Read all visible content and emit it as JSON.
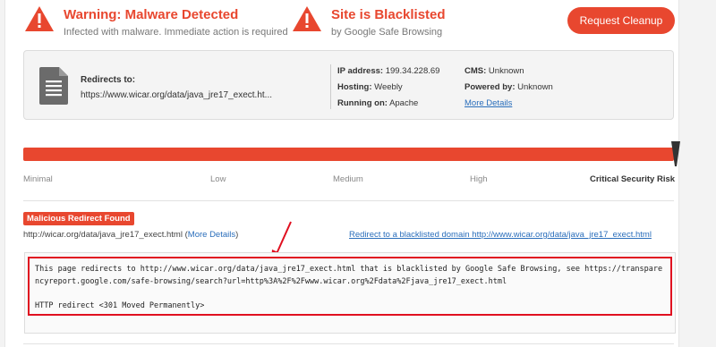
{
  "alerts": [
    {
      "title": "Warning: Malware Detected",
      "subtitle": "Infected with malware. Immediate action is required"
    },
    {
      "title": "Site is Blacklisted",
      "subtitle": "by Google Safe Browsing"
    }
  ],
  "actions": {
    "request_cleanup": "Request Cleanup"
  },
  "info": {
    "redirects_label": "Redirects to:",
    "redirects_url": "https://www.wicar.org/data/java_jre17_exect.ht...",
    "ip_label": "IP address:",
    "ip_value": "199.34.228.69",
    "hosting_label": "Hosting:",
    "hosting_value": "Weebly",
    "running_label": "Running on:",
    "running_value": "Apache",
    "cms_label": "CMS:",
    "cms_value": "Unknown",
    "powered_label": "Powered by:",
    "powered_value": "Unknown",
    "more_details": "More Details"
  },
  "risk": {
    "levels": [
      "Minimal",
      "Low",
      "Medium",
      "High",
      "Critical Security Risk"
    ],
    "current": "Critical Security Risk",
    "fill_fraction": 1.0
  },
  "finding": {
    "badge": "Malicious Redirect Found",
    "url": "http://wicar.org/data/java_jre17_exect.html",
    "more_prefix": "(",
    "more_details": "More Details",
    "more_suffix": ")",
    "blacklist_link": "Redirect to a blacklisted domain http://www.wicar.org/data/java_jre17_exect.html",
    "code_line_1": "This page redirects to http://www.wicar.org/data/java_jre17_exect.html that is blacklisted by Google Safe Browsing, see https://transpare",
    "code_line_2": "ncyreport.google.com/safe-browsing/search?url=http%3A%2F%2Fwww.wicar.org%2Fdata%2Fjava_jre17_exect.html",
    "code_line_3": "HTTP redirect <301 Moved Permanently>"
  },
  "colors": {
    "accent": "#e8472f",
    "link": "#2a6ebb",
    "highlight": "#e01020"
  },
  "icons": [
    "warning-icon",
    "document-icon",
    "risk-pointer-icon",
    "annotation-arrow-icon"
  ]
}
